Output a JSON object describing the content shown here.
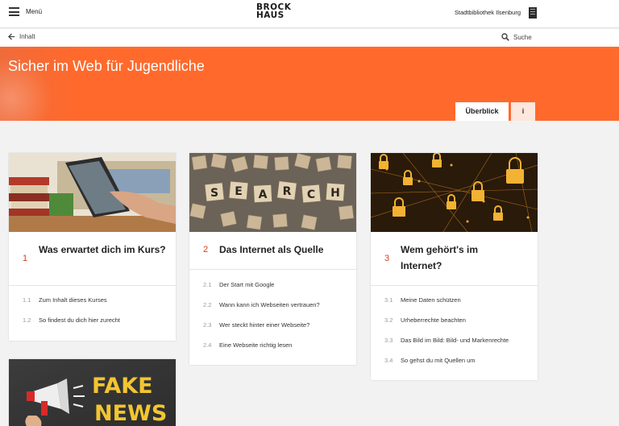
{
  "header": {
    "menu_label": "Menü",
    "logo_line1": "BROCK",
    "logo_line2": "HAUS",
    "library": "Stadtbibliothek Ilsenburg"
  },
  "subbar": {
    "back_label": "Inhalt",
    "search_label": "Suche"
  },
  "hero": {
    "title": "Sicher im Web für Jugendliche",
    "tab_overview": "Überblick",
    "tab_info": "i"
  },
  "chapters": [
    {
      "number": "1",
      "title": "Was erwartet dich im Kurs?",
      "image": "books-tablet",
      "items": [
        {
          "number": "1.1",
          "label": "Zum Inhalt dieses Kurses"
        },
        {
          "number": "1.2",
          "label": "So findest du dich hier zurecht"
        }
      ]
    },
    {
      "number": "2",
      "title": "Das Internet als Quelle",
      "image": "search-tiles",
      "tiles": [
        "S",
        "E",
        "A",
        "R",
        "C",
        "H"
      ],
      "items": [
        {
          "number": "2.1",
          "label": "Der Start mit Google"
        },
        {
          "number": "2.2",
          "label": "Wann kann ich Webseiten vertrauen?"
        },
        {
          "number": "2.3",
          "label": "Wer steckt hinter einer Webseite?"
        },
        {
          "number": "2.4",
          "label": "Eine Webseite richtig lesen"
        }
      ]
    },
    {
      "number": "3",
      "title": "Wem gehört's im Internet?",
      "image": "padlock-network",
      "items": [
        {
          "number": "3.1",
          "label": "Meine Daten schützen"
        },
        {
          "number": "3.2",
          "label": "Urheberrechte beachten"
        },
        {
          "number": "3.3",
          "label": "Das Bild im Bild: Bild- und Markenrechte"
        },
        {
          "number": "3.4",
          "label": "So gehst du mit Quellen um"
        }
      ]
    },
    {
      "image": "megaphone-fake-news",
      "image_text_1": "FAKE",
      "image_text_2": "NEWS"
    }
  ],
  "colors": {
    "accent": "#ff6a2c",
    "chapter_number": "#d83a15"
  }
}
